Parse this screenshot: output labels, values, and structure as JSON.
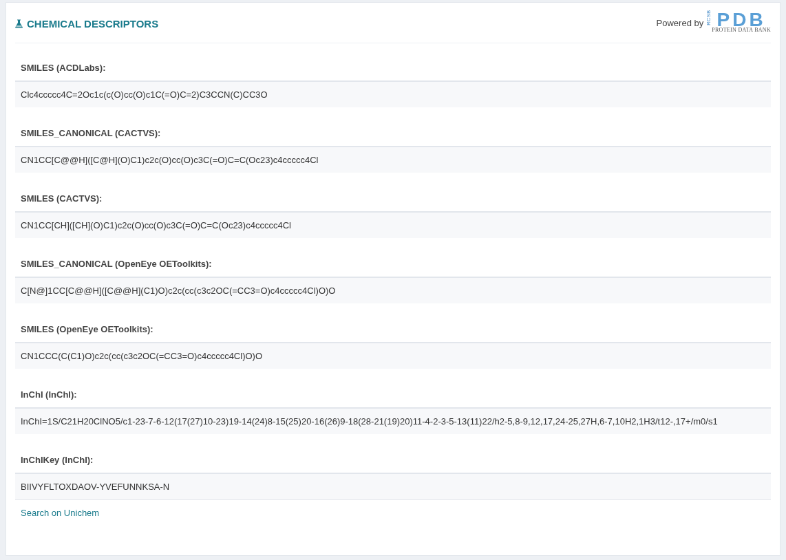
{
  "panel": {
    "title": "CHEMICAL DESCRIPTORS",
    "powered_by": "Powered by",
    "logo": {
      "side": "RCSB",
      "letters": "PDB",
      "tagline": "PROTEIN DATA BANK"
    }
  },
  "descriptors": [
    {
      "label": "SMILES (ACDLabs):",
      "value": "Clc4ccccc4C=2Oc1c(c(O)cc(O)c1C(=O)C=2)C3CCN(C)CC3O"
    },
    {
      "label": "SMILES_CANONICAL (CACTVS):",
      "value": "CN1CC[C@@H]([C@H](O)C1)c2c(O)cc(O)c3C(=O)C=C(Oc23)c4ccccc4Cl"
    },
    {
      "label": "SMILES (CACTVS):",
      "value": "CN1CC[CH]([CH](O)C1)c2c(O)cc(O)c3C(=O)C=C(Oc23)c4ccccc4Cl"
    },
    {
      "label": "SMILES_CANONICAL (OpenEye OEToolkits):",
      "value": "C[N@]1CC[C@@H]([C@@H](C1)O)c2c(cc(c3c2OC(=CC3=O)c4ccccc4Cl)O)O"
    },
    {
      "label": "SMILES (OpenEye OEToolkits):",
      "value": "CN1CCC(C(C1)O)c2c(cc(c3c2OC(=CC3=O)c4ccccc4Cl)O)O"
    },
    {
      "label": "InChI (InChI):",
      "value": "InChI=1S/C21H20ClNO5/c1-23-7-6-12(17(27)10-23)19-14(24)8-15(25)20-16(26)9-18(28-21(19)20)11-4-2-3-5-13(11)22/h2-5,8-9,12,17,24-25,27H,6-7,10H2,1H3/t12-,17+/m0/s1"
    },
    {
      "label": "InChIKey (InChI):",
      "value": "BIIVYFLTOXDAOV-YVEFUNNKSA-N"
    }
  ],
  "link": "Search on Unichem"
}
